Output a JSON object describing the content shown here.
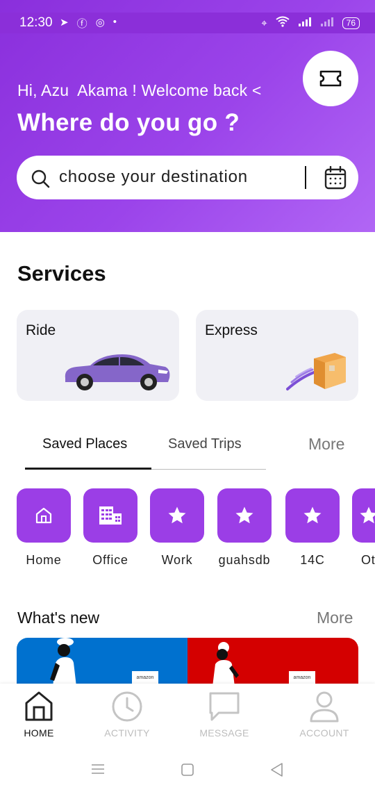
{
  "status_bar": {
    "time": "12:30",
    "battery": "76"
  },
  "header": {
    "greeting": "Hi, Azu  Akama ! Welcome back <",
    "question": "Where do you go ?"
  },
  "search": {
    "placeholder": "choose your destination"
  },
  "services": {
    "title": "Services",
    "items": [
      {
        "label": "Ride"
      },
      {
        "label": "Express"
      }
    ]
  },
  "tabs": {
    "saved_places": "Saved Places",
    "saved_trips": "Saved Trips",
    "more": "More"
  },
  "saved_places": [
    {
      "label": "Home",
      "icon": "home-icon"
    },
    {
      "label": "Office",
      "icon": "building-icon"
    },
    {
      "label": "Work",
      "icon": "star-icon"
    },
    {
      "label": "guahsdb",
      "icon": "star-icon"
    },
    {
      "label": "14C",
      "icon": "star-icon"
    },
    {
      "label": "Ot",
      "icon": "star-icon"
    }
  ],
  "whats_new": {
    "title": "What's new",
    "more": "More",
    "bag_text": "amazon"
  },
  "bottom_nav": [
    {
      "label": "HOME",
      "active": true
    },
    {
      "label": "ACTIVITY",
      "active": false
    },
    {
      "label": "MESSAGE",
      "active": false
    },
    {
      "label": "ACCOUNT",
      "active": false
    }
  ],
  "colors": {
    "accent": "#9b3ee6",
    "header": "#8a2fdc",
    "inactive": "#bdbdbd"
  }
}
